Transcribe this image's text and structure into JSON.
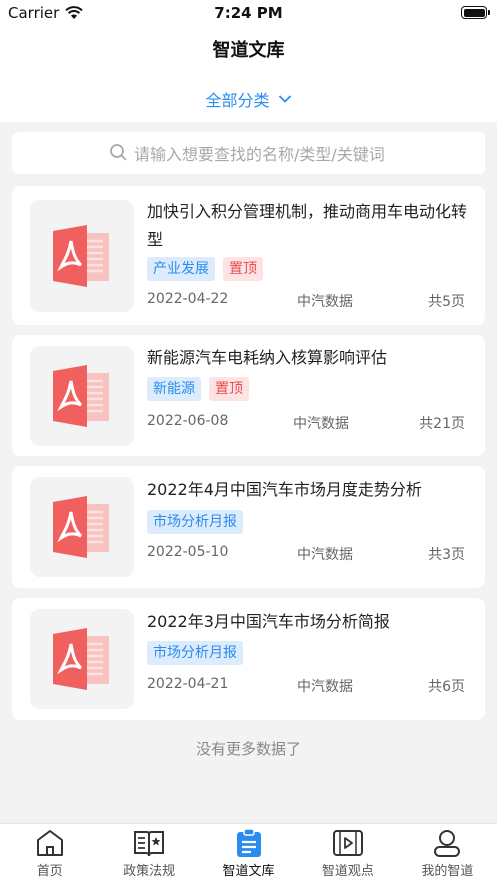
{
  "status_bar": {
    "carrier": "Carrier",
    "time": "7:24 PM"
  },
  "header": {
    "title": "智道文库"
  },
  "filter": {
    "label": "全部分类"
  },
  "search": {
    "placeholder": "请输入想要查找的名称/类型/关键词"
  },
  "documents": [
    {
      "title": "加快引入积分管理机制，推动商用车电动化转型",
      "tags": [
        "产业发展",
        "置顶"
      ],
      "date": "2022-04-22",
      "source": "中汽数据",
      "pages": "共5页"
    },
    {
      "title": "新能源汽车电耗纳入核算影响评估",
      "tags": [
        "新能源",
        "置顶"
      ],
      "date": "2022-06-08",
      "source": "中汽数据",
      "pages": "共21页"
    },
    {
      "title": "2022年4月中国汽车市场月度走势分析",
      "tags": [
        "市场分析月报"
      ],
      "date": "2022-05-10",
      "source": "中汽数据",
      "pages": "共3页"
    },
    {
      "title": "2022年3月中国汽车市场分析简报",
      "tags": [
        "市场分析月报"
      ],
      "date": "2022-04-21",
      "source": "中汽数据",
      "pages": "共6页"
    }
  ],
  "footer": {
    "no_more": "没有更多数据了"
  },
  "tabbar": [
    {
      "label": "首页",
      "icon": "home-icon"
    },
    {
      "label": "政策法规",
      "icon": "policy-book-icon"
    },
    {
      "label": "智道文库",
      "icon": "library-doc-icon"
    },
    {
      "label": "智道观点",
      "icon": "video-play-icon"
    },
    {
      "label": "我的智道",
      "icon": "user-icon"
    }
  ],
  "colors": {
    "accent": "#2a8cf0",
    "pdf": "#f0605e",
    "tag_red": "#e84c4c"
  }
}
